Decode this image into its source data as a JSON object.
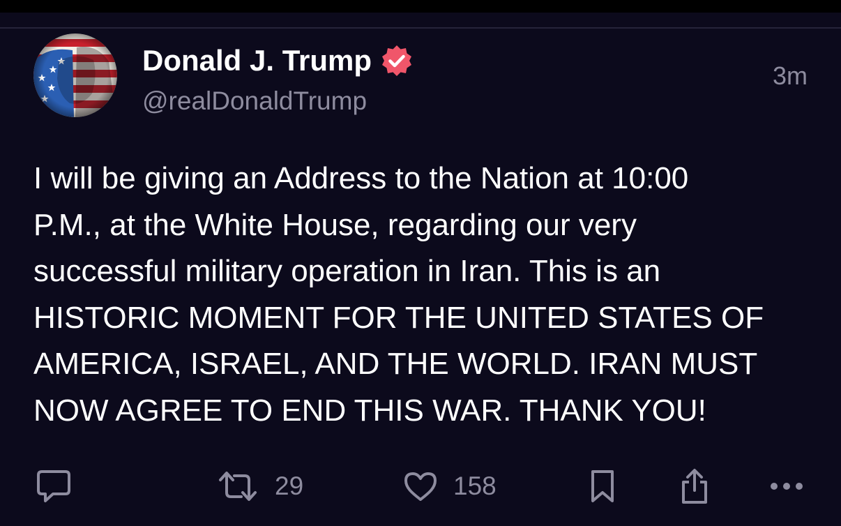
{
  "post": {
    "author": {
      "display_name": "Donald J. Trump",
      "handle": "@realDonaldTrump",
      "verified": true,
      "verified_color": "#f0566a",
      "avatar_icon": "avatar-image"
    },
    "timestamp": "3m",
    "text": "I will be giving an Address to the Nation at 10:00\nP.M., at the White House, regarding our very\nsuccessful military operation in Iran. This is an\nHISTORIC MOMENT FOR THE UNITED STATES OF\nAMERICA, ISRAEL, AND THE WORLD. IRAN MUST\nNOW AGREE TO END THIS WAR. THANK YOU!",
    "actions": {
      "reply": {
        "icon": "reply-icon"
      },
      "retruth": {
        "icon": "retruth-icon",
        "count": "29"
      },
      "like": {
        "icon": "heart-icon",
        "count": "158"
      },
      "bookmark": {
        "icon": "bookmark-icon"
      },
      "share": {
        "icon": "share-icon"
      },
      "more": {
        "icon": "more-icon"
      }
    }
  },
  "colors": {
    "background": "#0c0a1c",
    "text_primary": "#ffffff",
    "text_secondary": "#8e8c9f",
    "divider": "#26243a"
  }
}
